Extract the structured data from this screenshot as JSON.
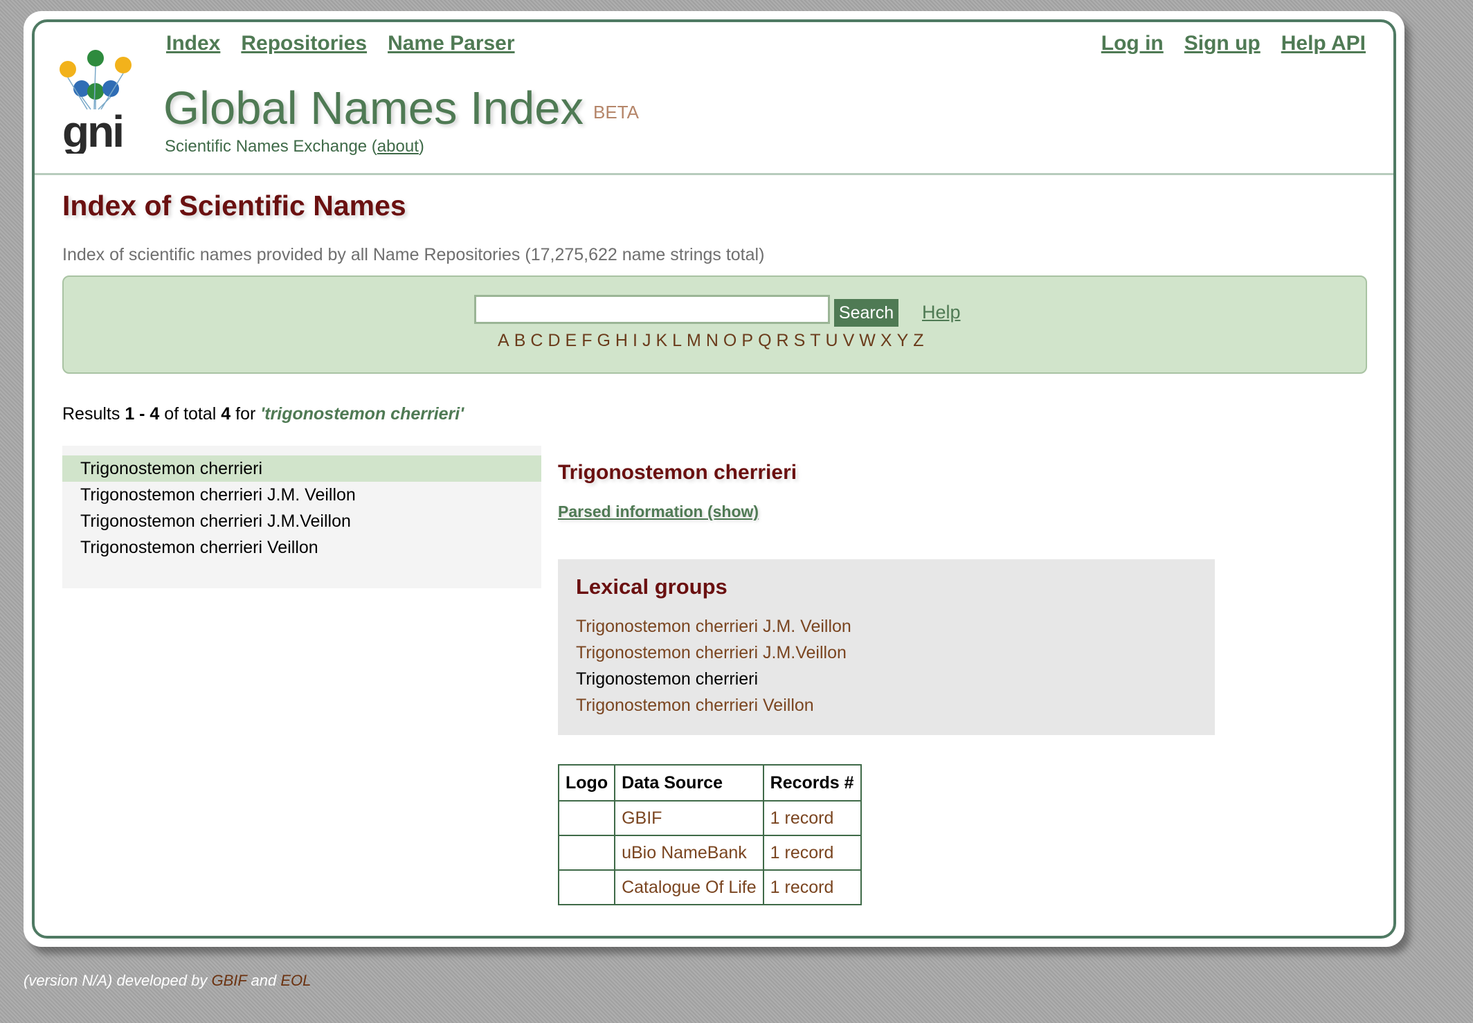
{
  "nav": {
    "left": [
      "Index",
      "Repositories",
      "Name Parser"
    ],
    "right": [
      "Log in",
      "Sign up",
      "Help API"
    ]
  },
  "logo": {
    "text": "gni",
    "colors": [
      "#f2b21b",
      "#2e8b3e",
      "#f2b21b",
      "#2f6db5",
      "#2e8b3e",
      "#2f6db5"
    ]
  },
  "header": {
    "title": "Global Names Index",
    "beta": "BETA",
    "tagline_prefix": "Scientific Names Exchange (",
    "tagline_link": "about",
    "tagline_suffix": ")"
  },
  "page": {
    "title": "Index of Scientific Names",
    "subtitle": "Index of scientific names provided by all Name Repositories (17,275,622 name strings total)"
  },
  "search": {
    "value": "",
    "button": "Search",
    "help": "Help",
    "letters": [
      "A",
      "B",
      "C",
      "D",
      "E",
      "F",
      "G",
      "H",
      "I",
      "J",
      "K",
      "L",
      "M",
      "N",
      "O",
      "P",
      "Q",
      "R",
      "S",
      "T",
      "U",
      "V",
      "W",
      "X",
      "Y",
      "Z"
    ]
  },
  "results": {
    "prefix": "Results ",
    "range": "1 - 4",
    "mid": " of total ",
    "total": "4",
    "for": " for ",
    "query": "'trigonostemon cherrieri'"
  },
  "names": [
    "Trigonostemon cherrieri",
    "Trigonostemon cherrieri J.M. Veillon",
    "Trigonostemon cherrieri J.M.Veillon",
    "Trigonostemon cherrieri Veillon"
  ],
  "selected_index": 0,
  "detail": {
    "title": "Trigonostemon cherrieri",
    "parsed_link": "Parsed information (show)",
    "lexical_title": "Lexical groups",
    "lexical_groups": [
      "Trigonostemon cherrieri J.M. Veillon",
      "Trigonostemon cherrieri J.M.Veillon",
      "Trigonostemon cherrieri",
      "Trigonostemon cherrieri Veillon"
    ],
    "lexical_current_index": 2,
    "table": {
      "headers": [
        "Logo",
        "Data Source",
        "Records #"
      ],
      "rows": [
        {
          "source": "GBIF",
          "records": "1 record"
        },
        {
          "source": "uBio NameBank",
          "records": "1 record"
        },
        {
          "source": "Catalogue Of Life",
          "records": "1 record"
        }
      ]
    }
  },
  "footer": {
    "prefix": "(version N/A) developed by ",
    "link1": "GBIF",
    "and": " and ",
    "link2": "EOL"
  }
}
